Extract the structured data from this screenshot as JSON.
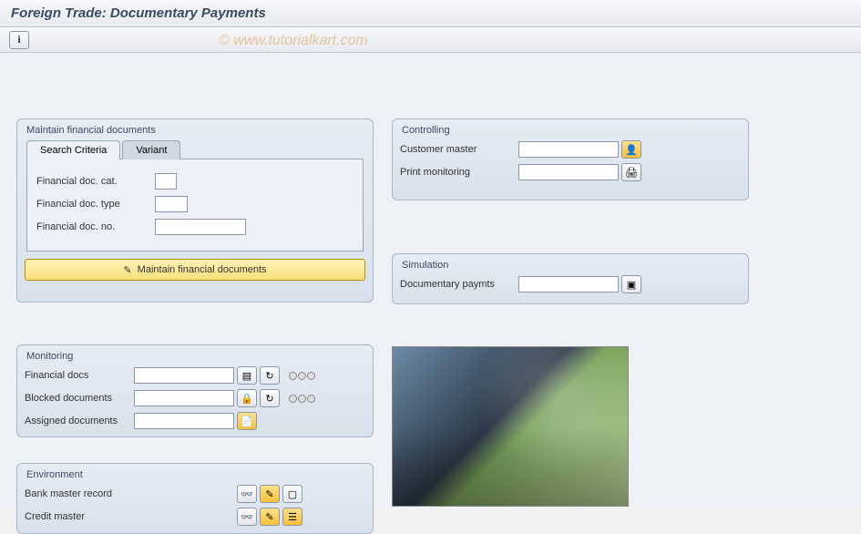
{
  "title": "Foreign Trade: Documentary Payments",
  "watermark": "© www.tutorialkart.com",
  "tabs": {
    "search": "Search Criteria",
    "variant": "Variant"
  },
  "maintain": {
    "title": "Maintain financial documents",
    "doc_cat": "Financial doc. cat.",
    "doc_type": "Financial doc. type",
    "doc_no": "Financial doc. no.",
    "button": "Maintain financial documents"
  },
  "controlling": {
    "title": "Controlling",
    "customer": "Customer master",
    "print": "Print monitoring"
  },
  "simulation": {
    "title": "Simulation",
    "docpay": "Documentary paymts"
  },
  "monitoring": {
    "title": "Monitoring",
    "fin": "Financial docs",
    "blocked": "Blocked documents",
    "assigned": "Assigned documents"
  },
  "environment": {
    "title": "Environment",
    "bank": "Bank master record",
    "credit": "Credit master"
  }
}
